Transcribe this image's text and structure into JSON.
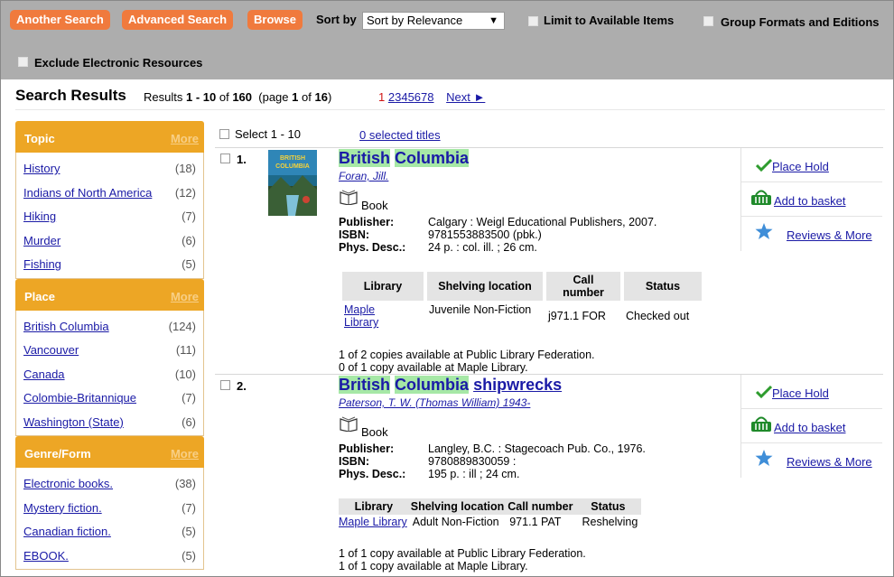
{
  "toolbar": {
    "another_search": "Another Search",
    "advanced_search": "Advanced Search",
    "browse": "Browse",
    "sort_by_label": "Sort by",
    "sort_value": "Sort by Relevance",
    "limit_available": "Limit to Available Items",
    "group_formats": "Group Formats and Editions",
    "exclude_electronic": "Exclude Electronic Resources"
  },
  "results_header": {
    "title": "Search Results",
    "results_word": "Results",
    "range": "1 - 10",
    "of_word": "of",
    "total": "160",
    "page_word": "(page",
    "page_current": "1",
    "page_of": "of",
    "page_total": "16",
    "page_close": ")",
    "pages": [
      "1",
      "2",
      "3",
      "4",
      "5",
      "6",
      "7",
      "8"
    ],
    "next": "Next ►"
  },
  "facets": [
    {
      "title": "Topic",
      "more": "More",
      "items": [
        {
          "label": "History",
          "count": "(18)"
        },
        {
          "label": "Indians of North America",
          "count": "(12)"
        },
        {
          "label": "Hiking",
          "count": "(7)"
        },
        {
          "label": "Murder",
          "count": "(6)"
        },
        {
          "label": "Fishing",
          "count": "(5)"
        }
      ]
    },
    {
      "title": "Place",
      "more": "More",
      "items": [
        {
          "label": "British Columbia",
          "count": "(124)"
        },
        {
          "label": "Vancouver",
          "count": "(11)"
        },
        {
          "label": "Canada",
          "count": "(10)"
        },
        {
          "label": "Colombie-Britannique",
          "count": "(7)"
        },
        {
          "label": "Washington (State)",
          "count": "(6)"
        }
      ]
    },
    {
      "title": "Genre/Form",
      "more": "More",
      "items": [
        {
          "label": "Electronic books.",
          "count": "(38)"
        },
        {
          "label": "Mystery fiction.",
          "count": "(7)"
        },
        {
          "label": "Canadian fiction.",
          "count": "(5)"
        },
        {
          "label": "EBOOK.",
          "count": "(5)"
        }
      ]
    }
  ],
  "select_all_label": "Select 1 - 10",
  "selected_titles": "0 selected titles",
  "results": [
    {
      "number": "1.",
      "title_hl_1": "British",
      "title_hl_2": "Columbia",
      "title_rest": "",
      "author": "Foran, Jill.",
      "format": "Book",
      "cover_text": "BRITISH COLUMBIA",
      "publisher_label": "Publisher:",
      "publisher": "Calgary : Weigl Educational Publishers, 2007.",
      "isbn_label": "ISBN:",
      "isbn": "9781553883500 (pbk.)",
      "phys_label": "Phys. Desc.:",
      "phys": "24 p. : col. ill. ; 26 cm.",
      "table_headers": [
        "Library",
        "Shelving location",
        "Call number",
        "Status"
      ],
      "copy_row": {
        "library": "Maple Library",
        "location": "Juvenile Non-Fiction",
        "call_number": "j971.1 FOR",
        "status": "Checked out"
      },
      "availability": [
        "1 of 2 copies available at Public Library Federation.",
        "0 of 1 copy available at Maple Library."
      ]
    },
    {
      "number": "2.",
      "title_hl_1": "British",
      "title_hl_2": "Columbia",
      "title_rest": "shipwrecks",
      "author": "Paterson, T. W. (Thomas William) 1943-",
      "format": "Book",
      "publisher_label": "Publisher:",
      "publisher": "Langley, B.C. : Stagecoach Pub. Co., 1976.",
      "isbn_label": "ISBN:",
      "isbn": "9780889830059 :",
      "phys_label": "Phys. Desc.:",
      "phys": "195 p. : ill ; 24 cm.",
      "table_headers": [
        "Library",
        "Shelving location",
        "Call number",
        "Status"
      ],
      "copy_row": {
        "library": "Maple Library",
        "location": "Adult Non-Fiction",
        "call_number": "971.1 PAT",
        "status": "Reshelving"
      },
      "availability": [
        "1 of 1 copy available at Public Library Federation.",
        "1 of 1 copy available at Maple Library."
      ]
    }
  ],
  "actions": {
    "place_hold": "Place Hold",
    "add_to_basket": "Add to basket",
    "reviews_more": "Reviews & More"
  },
  "colors": {
    "button_orange": "#f07a3d",
    "facet_gold": "#eda625",
    "toolbar_gray": "#adadad",
    "highlight_green": "#a6e8a6",
    "link_blue": "#1a1aa6",
    "current_page_red": "#d01515"
  }
}
